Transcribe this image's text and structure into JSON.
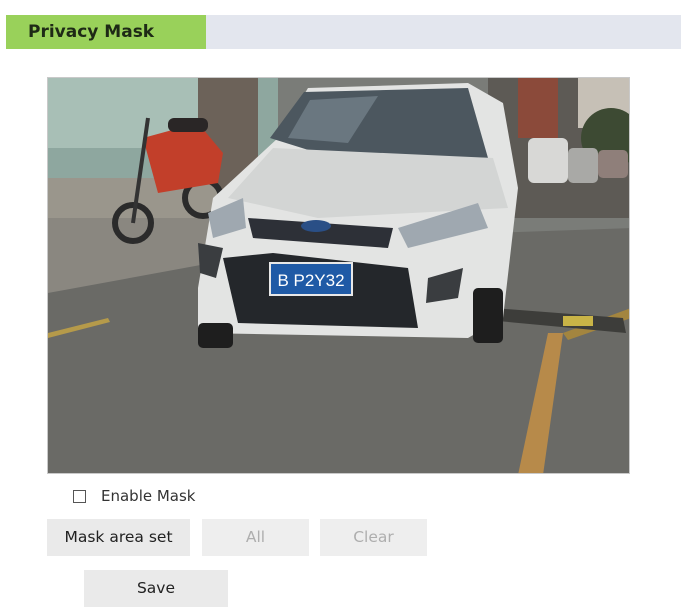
{
  "panel": {
    "title": "Privacy Mask"
  },
  "preview": {
    "plate_text": "B P2Y32"
  },
  "controls": {
    "enable_mask_label": "Enable Mask",
    "enable_mask_checked": false,
    "mask_area_set_label": "Mask area set",
    "all_label": "All",
    "clear_label": "Clear",
    "save_label": "Save"
  }
}
